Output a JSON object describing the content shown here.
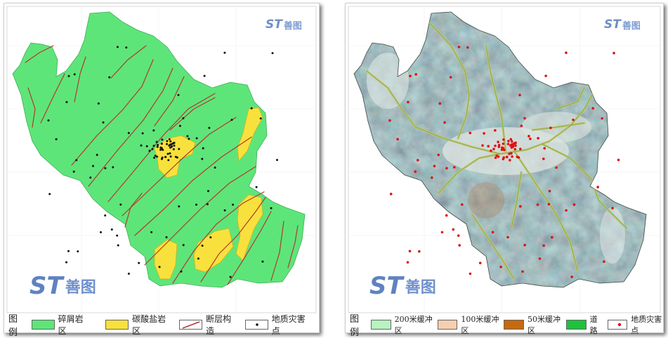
{
  "panels": [
    {
      "legend_title": "图例",
      "watermark_top": {
        "logo": "ST",
        "text": "善图"
      },
      "watermark_bottom": {
        "logo": "ST",
        "text": "善图"
      },
      "legend": [
        {
          "label": "碎屑岩区",
          "color": "#5ee57a"
        },
        {
          "label": "碳酸盐岩区",
          "color": "#f8e13c"
        },
        {
          "label": "断层构造",
          "color": "#b03a2e"
        },
        {
          "label": "地质灾害点",
          "color": "#111111"
        }
      ]
    },
    {
      "legend_title": "图例",
      "watermark_top": {
        "logo": "ST",
        "text": "善图"
      },
      "watermark_bottom": {
        "logo": "ST",
        "text": "善图"
      },
      "legend": [
        {
          "label": "200米缓冲区",
          "color": "#b7f2bf"
        },
        {
          "label": "100米缓冲区",
          "color": "#f6cfae"
        },
        {
          "label": "50米缓冲区",
          "color": "#c56a10"
        },
        {
          "label": "道路",
          "color": "#1fc23c"
        },
        {
          "label": "地质灾害点",
          "color": "#e01010"
        }
      ]
    }
  ]
}
